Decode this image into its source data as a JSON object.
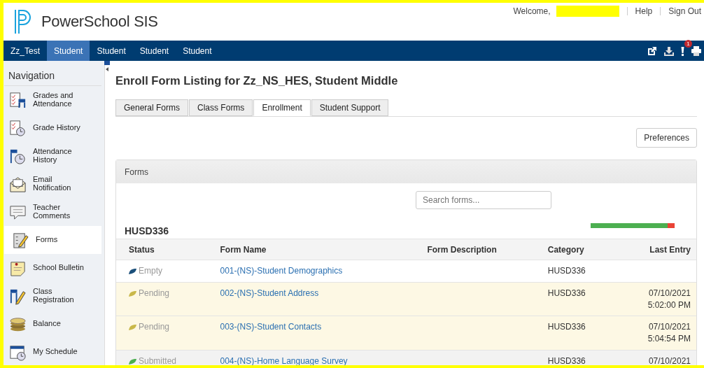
{
  "header": {
    "logo_text": "PowerSchool SIS",
    "welcome": "Welcome,",
    "links": [
      "Help",
      "Sign Out"
    ]
  },
  "navbar": {
    "items": [
      {
        "label": "Zz_Test",
        "selected": false
      },
      {
        "label": "Student",
        "selected": true
      },
      {
        "label": "Student",
        "selected": false
      },
      {
        "label": "Student",
        "selected": false
      },
      {
        "label": "Student",
        "selected": false
      }
    ],
    "alert_count": "1"
  },
  "sidebar": {
    "title": "Navigation",
    "items": [
      {
        "label": "Grades and Attendance",
        "selected": false
      },
      {
        "label": "Grade History",
        "selected": false
      },
      {
        "label": "Attendance History",
        "selected": false
      },
      {
        "label": "Email Notification",
        "selected": false
      },
      {
        "label": "Teacher Comments",
        "selected": false
      },
      {
        "label": "Forms",
        "selected": true
      },
      {
        "label": "School Bulletin",
        "selected": false
      },
      {
        "label": "Class Registration",
        "selected": false
      },
      {
        "label": "Balance",
        "selected": false
      },
      {
        "label": "My Schedule",
        "selected": false
      }
    ]
  },
  "page_title": "Enroll Form Listing for Zz_NS_HES, Student Middle",
  "tabs": [
    {
      "label": "General Forms",
      "selected": false
    },
    {
      "label": "Class Forms",
      "selected": false
    },
    {
      "label": "Enrollment",
      "selected": true
    },
    {
      "label": "Student Support",
      "selected": false
    }
  ],
  "preferences_button": "Preferences",
  "panel": {
    "title": "Forms",
    "search": {
      "placeholder": "Search forms..."
    },
    "group": "HUSD336",
    "progress": {
      "level": 0.92
    },
    "table": {
      "columns": [
        "Status",
        "Form Name",
        "Form Description",
        "Category",
        "Last Entry"
      ],
      "rows": [
        {
          "kind": "empty",
          "status": "Empty",
          "color": "#1b4f7a",
          "form_name": "001-(NS)-Student Demographics",
          "category": "HUSD336",
          "last_entry": []
        },
        {
          "kind": "pending",
          "status": "Pending",
          "color": "#c9b84a",
          "form_name": "002-(NS)-Student Address",
          "category": "HUSD336",
          "last_entry": [
            "07/10/2021",
            "5:02:00 PM"
          ]
        },
        {
          "kind": "pending",
          "status": "Pending",
          "color": "#c9b84a",
          "form_name": "003-(NS)-Student Contacts",
          "category": "HUSD336",
          "last_entry": [
            "07/10/2021",
            "5:04:54 PM"
          ]
        },
        {
          "kind": "submitted",
          "status": "Submitted",
          "color": "#4caf50",
          "form_name": "004-(NS)-Home Language Survey",
          "category": "HUSD336",
          "last_entry": [
            "07/10/2021"
          ]
        }
      ]
    }
  }
}
